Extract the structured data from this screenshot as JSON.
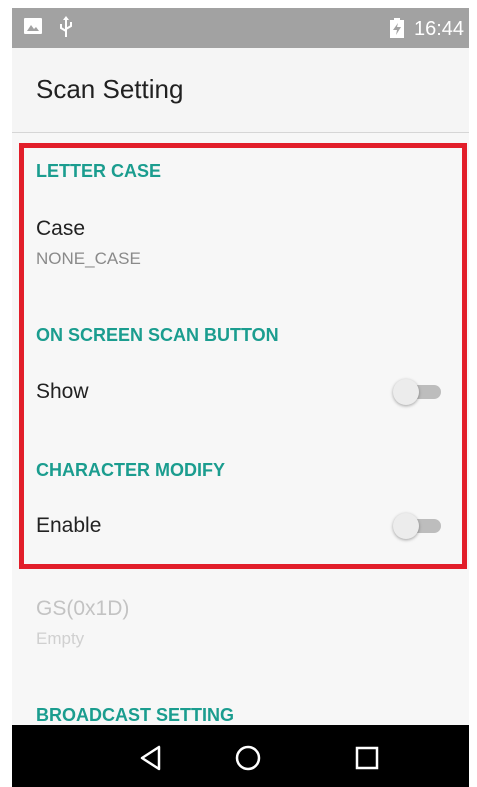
{
  "status_bar": {
    "time": "16:44",
    "icons": [
      "image-icon",
      "usb-icon",
      "battery-charging-icon"
    ]
  },
  "app_bar": {
    "title": "Scan Setting"
  },
  "sections": {
    "letter_case": {
      "header": "LETTER CASE",
      "case_title": "Case",
      "case_value": "NONE_CASE"
    },
    "scan_button": {
      "header": "ON SCREEN SCAN BUTTON",
      "show_label": "Show",
      "show_enabled": false
    },
    "char_modify": {
      "header": "CHARACTER MODIFY",
      "enable_label": "Enable",
      "enable_enabled": false,
      "gs_title": "GS(0x1D)",
      "gs_value": "Empty"
    },
    "broadcast": {
      "header": "BROADCAST SETTING"
    }
  },
  "nav_bar": {
    "icons": [
      "back-icon",
      "home-icon",
      "recents-icon"
    ]
  },
  "colors": {
    "accent": "#1b9d8f",
    "highlight": "#e21e2a",
    "status_bar": "#a2a2a2"
  }
}
